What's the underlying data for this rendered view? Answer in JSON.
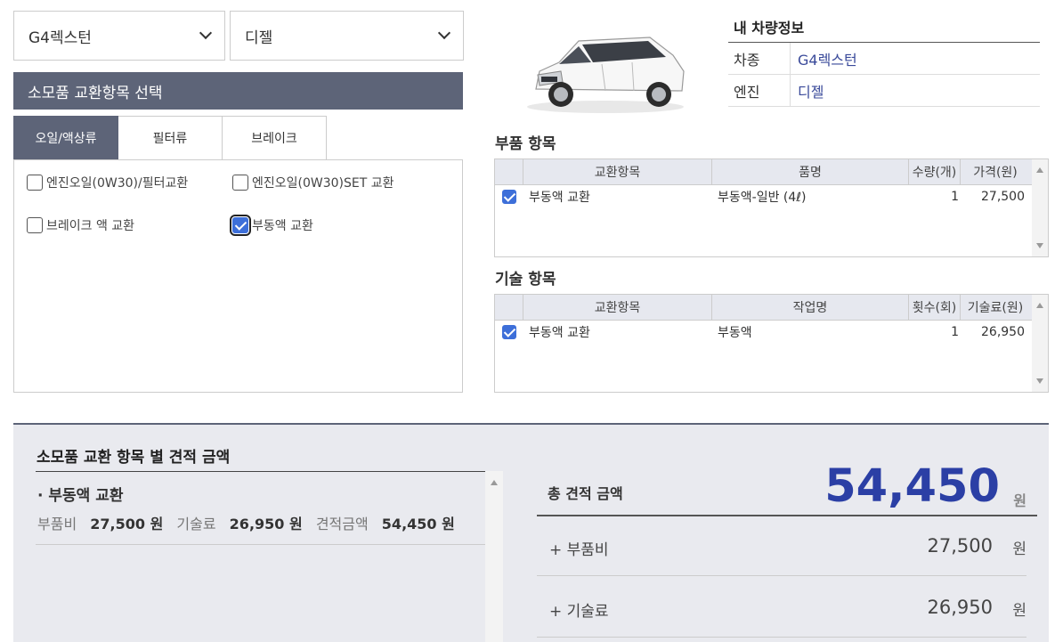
{
  "selectors": {
    "car": "G4렉스턴",
    "engine": "디젤"
  },
  "section_title": "소모품 교환항목 선택",
  "tabs": [
    {
      "label": "오일/액상류",
      "active": true
    },
    {
      "label": "필터류",
      "active": false
    },
    {
      "label": "브레이크",
      "active": false
    }
  ],
  "checks": [
    {
      "label": "엔진오일(0W30)/필터교환",
      "checked": false
    },
    {
      "label": "엔진오일(0W30)SET 교환",
      "checked": false
    },
    {
      "label": "브레이크 액 교환",
      "checked": false
    },
    {
      "label": "부동액 교환",
      "checked": true
    }
  ],
  "vehicle_info": {
    "title": "내 차량정보",
    "rows": [
      {
        "key": "차종",
        "value": "G4렉스턴"
      },
      {
        "key": "엔진",
        "value": "디젤"
      }
    ]
  },
  "parts": {
    "title": "부품 항목",
    "headers": [
      "교환항목",
      "품명",
      "수량(개)",
      "가격(원)"
    ],
    "rows": [
      {
        "item": "부동액 교환",
        "name": "부동액-일반 (4ℓ)",
        "qty": "1",
        "price": "27,500",
        "checked": true
      }
    ]
  },
  "labor": {
    "title": "기술 항목",
    "headers": [
      "교환항목",
      "작업명",
      "횟수(회)",
      "기술료(원)"
    ],
    "rows": [
      {
        "item": "부동액 교환",
        "name": "부동액",
        "qty": "1",
        "price": "26,950",
        "checked": true
      }
    ]
  },
  "estimate": {
    "title": "소모품 교환 항목 별 견적 금액",
    "item_name": "· 부동액 교환",
    "parts_label": "부품비",
    "parts_value": "27,500 원",
    "labor_label": "기술료",
    "labor_value": "26,950 원",
    "total_label": "견적금액",
    "total_value": "54,450 원"
  },
  "totals": {
    "label": "총 견적 금액",
    "amount": "54,450",
    "unit": "원",
    "parts_label": "+ 부품비",
    "parts_amount": "27,500",
    "labor_label": "+ 기술료",
    "labor_amount": "26,950",
    "sub_unit": "원"
  },
  "colors": {
    "accent_bar": "#5d6478",
    "total_value": "#2b3fa5",
    "checkbox": "#3d6fd9"
  }
}
